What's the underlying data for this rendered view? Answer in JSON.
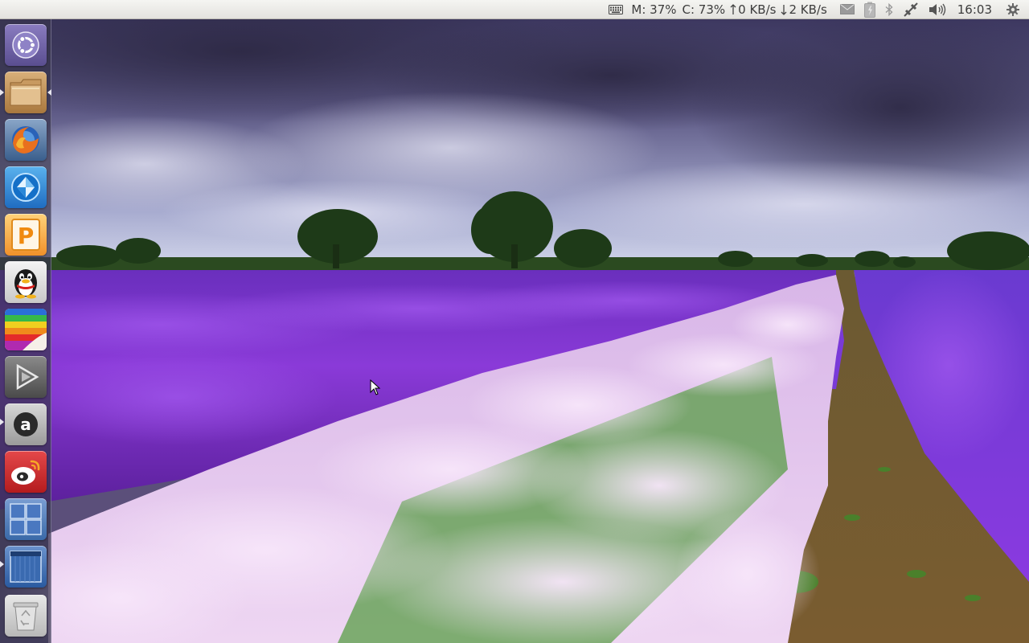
{
  "top_panel": {
    "indicators": [
      {
        "id": "keyboard",
        "icon": "keyboard-icon"
      },
      {
        "id": "sysmonitor",
        "memory": "M: 37%",
        "cpu": "C: 73%",
        "upload": "0 KB/s",
        "download": "2 KB/s"
      },
      {
        "id": "messaging",
        "icon": "envelope-icon"
      },
      {
        "id": "power",
        "icon": "battery-icon"
      },
      {
        "id": "bluetooth",
        "icon": "bluetooth-icon"
      },
      {
        "id": "network",
        "icon": "network-icon"
      },
      {
        "id": "sound",
        "icon": "speaker-icon"
      },
      {
        "id": "clock",
        "time": "16:03"
      },
      {
        "id": "session",
        "icon": "gear-icon"
      }
    ]
  },
  "launcher": {
    "items": [
      {
        "name": "dash-home",
        "icon": "ubuntu-logo-icon",
        "running": false,
        "focused": false
      },
      {
        "name": "files",
        "icon": "folder-icon",
        "running": true,
        "focused": true
      },
      {
        "name": "firefox",
        "icon": "firefox-icon",
        "running": false,
        "focused": false
      },
      {
        "name": "blue-diamond-app",
        "icon": "blue-diamond-icon",
        "running": false,
        "focused": false
      },
      {
        "name": "wps-presentation",
        "icon": "presentation-p-icon",
        "running": false,
        "focused": false
      },
      {
        "name": "qq",
        "icon": "penguin-icon",
        "running": false,
        "focused": false
      },
      {
        "name": "color-picker",
        "icon": "color-palette-icon",
        "running": false,
        "focused": false
      },
      {
        "name": "media-player",
        "icon": "play-icon",
        "running": true,
        "focused": false
      },
      {
        "name": "amazon",
        "icon": "amazon-a-icon",
        "running": false,
        "focused": false
      },
      {
        "name": "weibo",
        "icon": "weibo-icon",
        "running": false,
        "focused": false
      },
      {
        "name": "workspace-switcher",
        "icon": "workspace-grid-icon",
        "running": false,
        "focused": false
      },
      {
        "name": "window-app",
        "icon": "window-icon",
        "running": true,
        "focused": false
      },
      {
        "name": "trash",
        "icon": "trash-icon",
        "running": false,
        "focused": false
      }
    ]
  },
  "colors": {
    "panel_bg": "#ebeae6",
    "panel_text": "#3c3c3c",
    "launcher_bg": "#37344e",
    "lavender": "#7a2fd0",
    "white_lavender": "#e8c8ee"
  }
}
